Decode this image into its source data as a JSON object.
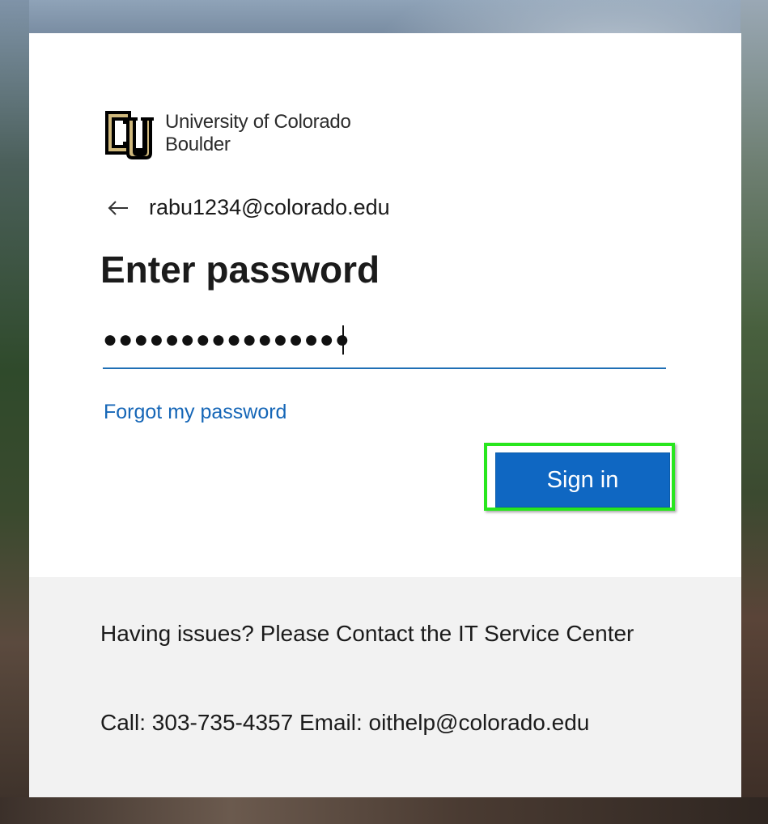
{
  "brand": {
    "logo_line1": "University of Colorado",
    "logo_line2": "Boulder",
    "logo_icon": "cu-boulder-logo",
    "logo_gold": "#cfb87c",
    "logo_black": "#000000"
  },
  "identity": {
    "back_icon": "back-arrow-icon",
    "email": "rabu1234@colorado.edu"
  },
  "form": {
    "title": "Enter password",
    "password_value": "●●●●●●●●●●●●●●●●",
    "forgot_link": "Forgot my password",
    "signin_label": "Sign in"
  },
  "footer": {
    "help": "Having issues? Please Contact the IT Service Center",
    "contact": "Call: 303-735-4357 Email: oithelp@colorado.edu"
  },
  "colors": {
    "accent": "#0f67c2",
    "link": "#1566b7",
    "highlight": "#28e61e",
    "footer_bg": "#f2f2f2"
  }
}
